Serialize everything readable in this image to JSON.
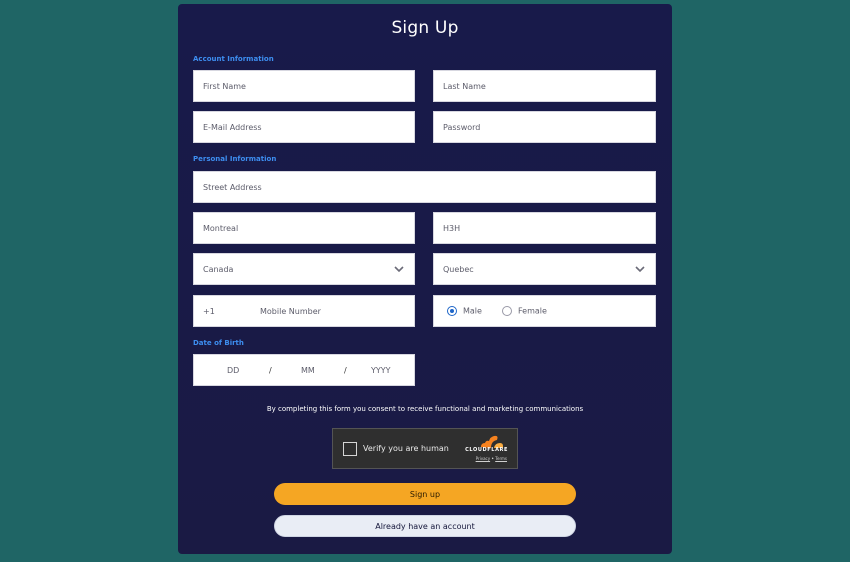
{
  "form": {
    "title": "Sign Up",
    "sections": {
      "account": "Account Information",
      "personal": "Personal Information",
      "dob": "Date of Birth"
    },
    "fields": {
      "first_name": "First Name",
      "last_name": "Last Name",
      "email": "E-Mail Address",
      "password": "Password",
      "street": "Street Address",
      "city": "Montreal",
      "postal": "H3H",
      "country": "Canada",
      "province": "Quebec",
      "phone_prefix": "+1",
      "mobile": "Mobile Number",
      "gender_male": "Male",
      "gender_female": "Female",
      "gender_selected": "Male",
      "dob_day": "DD",
      "dob_month": "MM",
      "dob_year": "YYYY",
      "dob_sep": "/"
    },
    "consent": "By completing this form you consent to receive functional and marketing communications",
    "captcha": {
      "label": "Verify you are human",
      "brand": "CLOUDFLARE",
      "privacy": "Privacy",
      "sep": "•",
      "terms": "Terms"
    },
    "buttons": {
      "signup": "Sign up",
      "have_account": "Already have an account"
    }
  },
  "colors": {
    "background": "#1f6565",
    "card": "#181a4a",
    "section_label": "#3d8ef0",
    "primary_button": "#f5a623",
    "secondary_button": "#e9edf5",
    "radio_selected": "#1e66c8"
  }
}
